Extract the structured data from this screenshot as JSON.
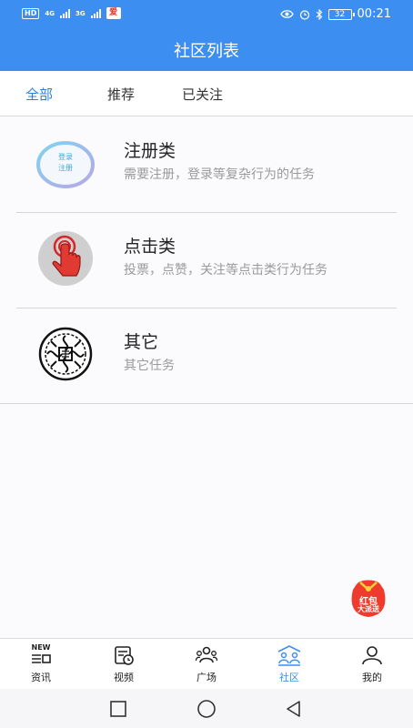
{
  "status_bar": {
    "left_badge": "HD",
    "net_primary": "4G",
    "net_secondary": "3G",
    "app_badge": "爱",
    "battery": "32",
    "time": "00:21"
  },
  "header": {
    "title": "社区列表"
  },
  "tabs": [
    {
      "label": "全部",
      "active": true
    },
    {
      "label": "推荐",
      "active": false
    },
    {
      "label": "已关注",
      "active": false
    }
  ],
  "categories": [
    {
      "title": "注册类",
      "desc": "需要注册，登录等复杂行为的任务",
      "icon": "register-login-icon",
      "icon_text_1": "登录",
      "icon_text_2": "注册"
    },
    {
      "title": "点击类",
      "desc": "投票，点赞，关注等点击类行为任务",
      "icon": "hand-tap-icon"
    },
    {
      "title": "其它",
      "desc": "其它任务",
      "icon": "ornament-seal-icon"
    }
  ],
  "floating": {
    "line1": "红包",
    "line2": "大派送"
  },
  "bottom_tabs": [
    {
      "label": "资讯",
      "icon": "news-icon",
      "icon_text": "NEW",
      "active": false
    },
    {
      "label": "视频",
      "icon": "video-icon",
      "active": false
    },
    {
      "label": "广场",
      "icon": "people-icon",
      "active": false
    },
    {
      "label": "社区",
      "icon": "community-icon",
      "active": true
    },
    {
      "label": "我的",
      "icon": "profile-icon",
      "active": false
    }
  ],
  "colors": {
    "primary": "#3d8ef1",
    "active_tab": "#2f7fd8",
    "desc_gray": "#9a9a9a",
    "red": "#e2302a"
  }
}
